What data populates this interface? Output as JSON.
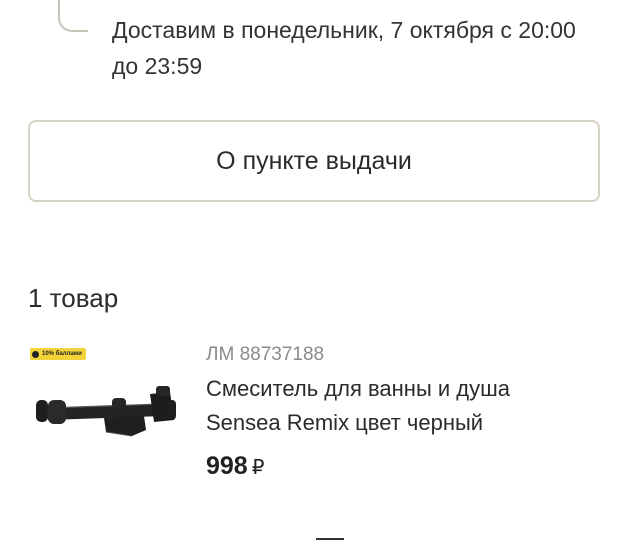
{
  "delivery": {
    "text": "Доставим в понедельник, 7 октября с 20:00 до 23:59"
  },
  "pickup_button": {
    "label": "О пункте выдачи"
  },
  "cart": {
    "items_count_label": "1 товар"
  },
  "product": {
    "bonus_badge": "10% баллами",
    "sku": "ЛМ 88737188",
    "title": "Смеситель для ванны и душа Sensea Remix цвет черный",
    "price": "998",
    "currency": "₽",
    "image_icon": "faucet-image"
  },
  "colors": {
    "border": "#d8d2c6",
    "badge": "#f2d43a",
    "text": "#2b2b2b",
    "muted": "#8a8a8a"
  }
}
